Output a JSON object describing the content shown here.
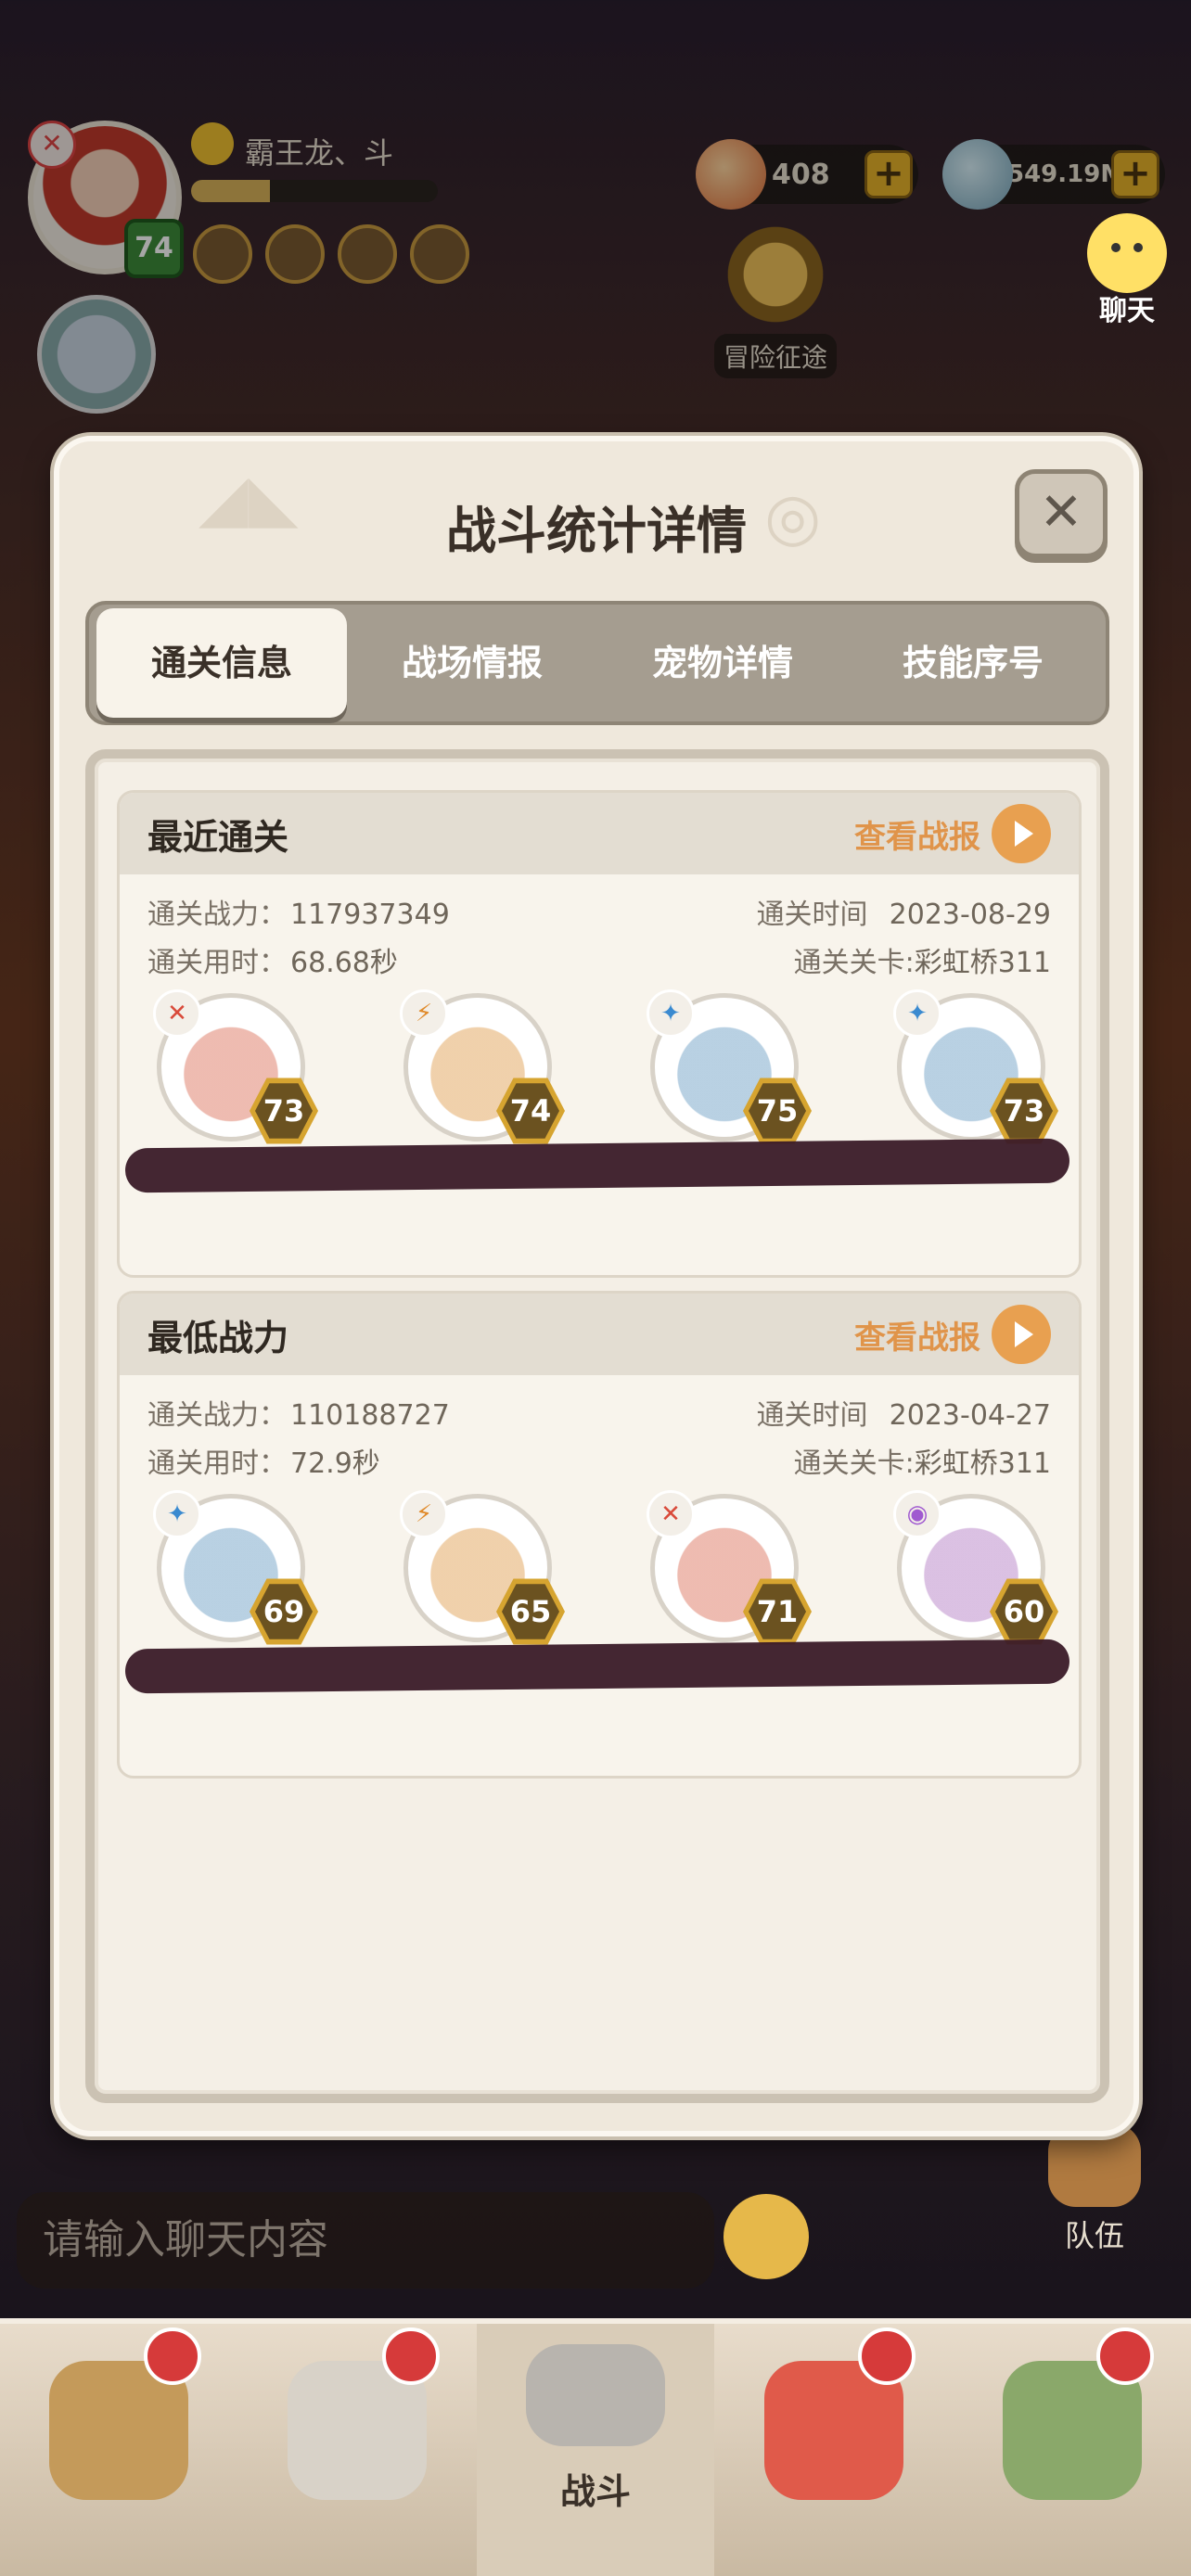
{
  "hud": {
    "player_name": "霸王龙、斗",
    "player_level": "74",
    "xp_fraction": 0.32,
    "gems": "408",
    "stones": "549.19M",
    "plus": "+",
    "journey_label": "冒险征途",
    "chat_label": "聊天"
  },
  "modal": {
    "title": "战斗统计详情",
    "close": "✕",
    "tabs": [
      "通关信息",
      "战场情报",
      "宠物详情",
      "技能序号"
    ],
    "active_tab": 0
  },
  "recent": {
    "title": "最近通关",
    "report": "查看战报",
    "power_label": "通关战力：",
    "power": "117937349",
    "time_used_label": "通关用时：",
    "time_used": "68.68秒",
    "date_label": "通关时间",
    "date": "2023-08-29",
    "stage_label": "通关关卡:",
    "stage": "彩虹桥311",
    "pets": [
      {
        "level": "73",
        "element": "fire",
        "color": "#d94a3a"
      },
      {
        "level": "74",
        "element": "thunder",
        "color": "#e08a2a"
      },
      {
        "level": "75",
        "element": "water",
        "color": "#3a8ad0"
      },
      {
        "level": "73",
        "element": "water",
        "color": "#3a8ad0"
      }
    ]
  },
  "lowest": {
    "title": "最低战力",
    "report": "查看战报",
    "power_label": "通关战力：",
    "power": "110188727",
    "time_used_label": "通关用时：",
    "time_used": "72.9秒",
    "date_label": "通关时间",
    "date": "2023-04-27",
    "stage_label": "通关关卡:",
    "stage": "彩虹桥311",
    "pets": [
      {
        "level": "69",
        "element": "water",
        "color": "#3a8ad0"
      },
      {
        "level": "65",
        "element": "thunder",
        "color": "#e08a2a"
      },
      {
        "level": "71",
        "element": "fire",
        "color": "#d94a3a"
      },
      {
        "level": "60",
        "element": "psychic",
        "color": "#a05ad0"
      }
    ]
  },
  "chat": {
    "placeholder": "请输入聊天内容",
    "team_label": "队伍"
  },
  "bottom_nav": {
    "battle_label": "战斗"
  }
}
